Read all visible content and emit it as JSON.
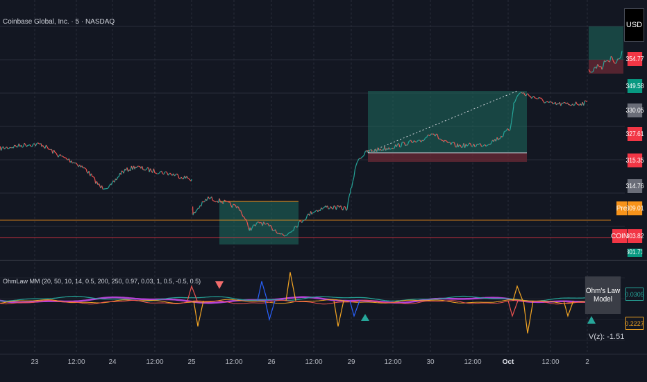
{
  "header": {
    "symbol_title": "Coinbase Global, Inc. · 5 · NASDAQ",
    "currency": "USD"
  },
  "indicator": {
    "title": "OhmLaw MM (20, 50, 10, 14, 0.5, 200, 250, 0.97, 0.03, 1, 0.5, -0.5, 0.5)",
    "model_label": "Ohm's Law Model",
    "vz_label": "V(z): -1.51",
    "values": [
      {
        "text": "0.0305",
        "color": "#26a69a"
      },
      {
        "text": "0.2227",
        "color": "#f5a623"
      }
    ]
  },
  "price_scale": [
    {
      "text": "354.77",
      "bg": "#f23645"
    },
    {
      "text": "349.58",
      "bg": "#089981"
    },
    {
      "text": "330.05",
      "bg": "#6a6d78"
    },
    {
      "text": "327.61",
      "bg": "#f23645"
    },
    {
      "text": "315.35",
      "bg": "#f23645"
    },
    {
      "text": "314.76",
      "bg": "#6a6d78"
    },
    {
      "text": "309.01",
      "bg": "#f7931a"
    },
    {
      "text": "303.82",
      "bg": "#f23645"
    },
    {
      "text": "301.71",
      "bg": "#089981"
    }
  ],
  "tags": {
    "pre": "Pre",
    "symbol": "COIN"
  },
  "time_axis": [
    {
      "text": "23",
      "bold": false
    },
    {
      "text": "12:00",
      "bold": false
    },
    {
      "text": "24",
      "bold": false
    },
    {
      "text": "12:00",
      "bold": false
    },
    {
      "text": "25",
      "bold": false
    },
    {
      "text": "12:00",
      "bold": false
    },
    {
      "text": "26",
      "bold": false
    },
    {
      "text": "12:00",
      "bold": false
    },
    {
      "text": "29",
      "bold": false
    },
    {
      "text": "12:00",
      "bold": false
    },
    {
      "text": "30",
      "bold": false
    },
    {
      "text": "12:00",
      "bold": false
    },
    {
      "text": "Oct",
      "bold": true
    },
    {
      "text": "12:00",
      "bold": false
    },
    {
      "text": "2",
      "bold": false
    }
  ],
  "colors": {
    "background": "#131722",
    "up": "#26a69a",
    "down": "#ef5350",
    "zone_green": "#1e6b5e",
    "zone_red": "#6b2a35",
    "ind_purple": "#b543d6",
    "ind_orange": "#f5a623",
    "ind_blue": "#2962ff"
  }
}
